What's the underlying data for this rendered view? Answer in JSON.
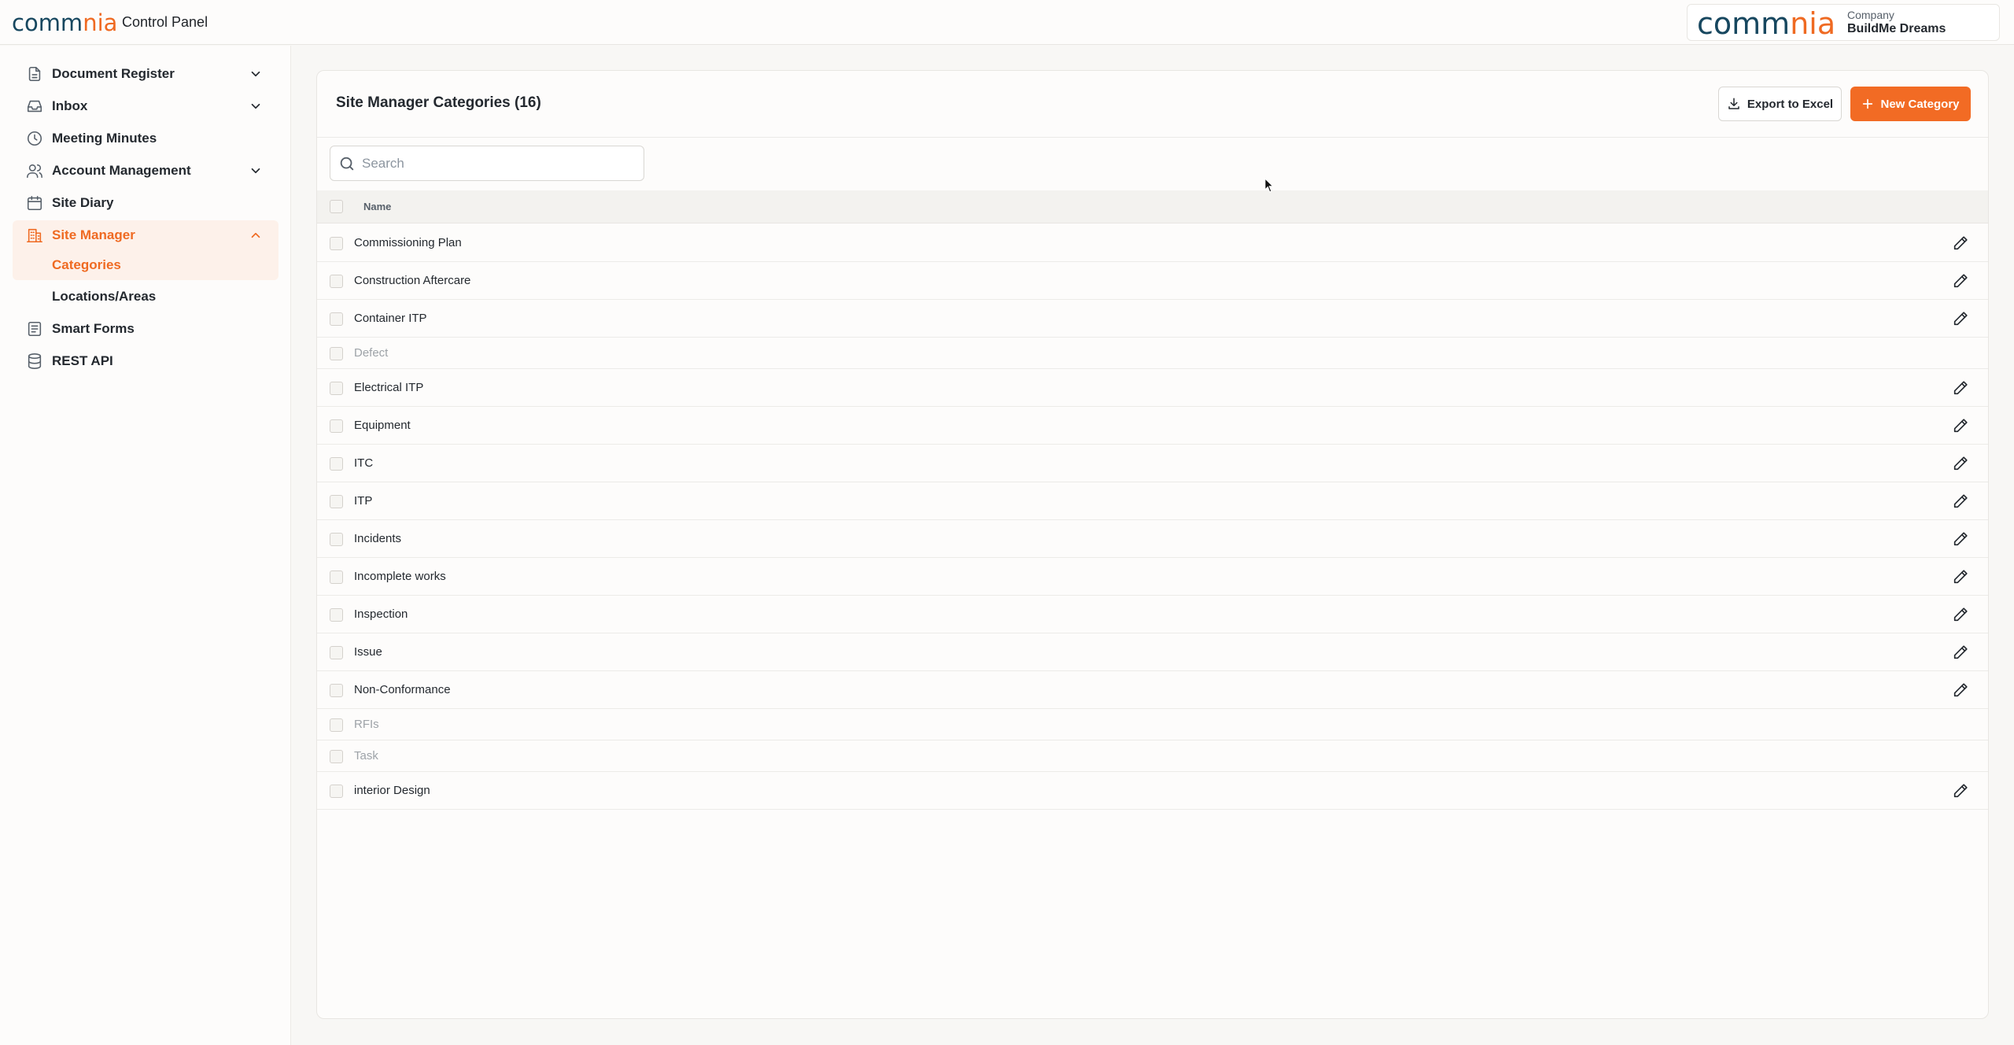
{
  "topbar": {
    "logo_text_a": "co",
    "logo_text_b": "mm",
    "logo_text_c": "nia",
    "title": "Control Panel",
    "company_label": "Company",
    "company_name": "BuildMe Dreams"
  },
  "sidebar": {
    "items": [
      {
        "label": "Document Register",
        "icon": "document-icon",
        "has_chevron": true
      },
      {
        "label": "Inbox",
        "icon": "inbox-icon",
        "has_chevron": true
      },
      {
        "label": "Meeting Minutes",
        "icon": "clock-icon",
        "has_chevron": false
      },
      {
        "label": "Account Management",
        "icon": "users-icon",
        "has_chevron": true
      },
      {
        "label": "Site Diary",
        "icon": "calendar-icon",
        "has_chevron": false
      },
      {
        "label": "Site Manager",
        "icon": "building-icon",
        "has_chevron": true,
        "expanded": true
      },
      {
        "label": "Smart Forms",
        "icon": "form-icon",
        "has_chevron": false
      },
      {
        "label": "REST API",
        "icon": "database-icon",
        "has_chevron": false
      }
    ],
    "subitems": [
      {
        "label": "Categories",
        "active": true
      },
      {
        "label": "Locations/Areas",
        "active": false
      }
    ]
  },
  "main": {
    "title": "Site Manager Categories (16)",
    "export_label": "Export to Excel",
    "new_label": "New Category",
    "search_placeholder": "Search",
    "column_name": "Name",
    "rows": [
      {
        "name": "Commissioning Plan",
        "editable": true
      },
      {
        "name": "Construction Aftercare",
        "editable": true
      },
      {
        "name": "Container ITP",
        "editable": true
      },
      {
        "name": "Defect",
        "editable": false
      },
      {
        "name": "Electrical ITP",
        "editable": true
      },
      {
        "name": "Equipment",
        "editable": true
      },
      {
        "name": "ITC",
        "editable": true
      },
      {
        "name": "ITP",
        "editable": true
      },
      {
        "name": "Incidents",
        "editable": true
      },
      {
        "name": "Incomplete works",
        "editable": true
      },
      {
        "name": "Inspection",
        "editable": true
      },
      {
        "name": "Issue",
        "editable": true
      },
      {
        "name": "Non-Conformance",
        "editable": true
      },
      {
        "name": "RFIs",
        "editable": false
      },
      {
        "name": "Task",
        "editable": false
      },
      {
        "name": "interior Design",
        "editable": true
      }
    ]
  },
  "colors": {
    "accent": "#f26b24",
    "brand_dark": "#17475f",
    "active_bg": "#fdf1ea"
  }
}
